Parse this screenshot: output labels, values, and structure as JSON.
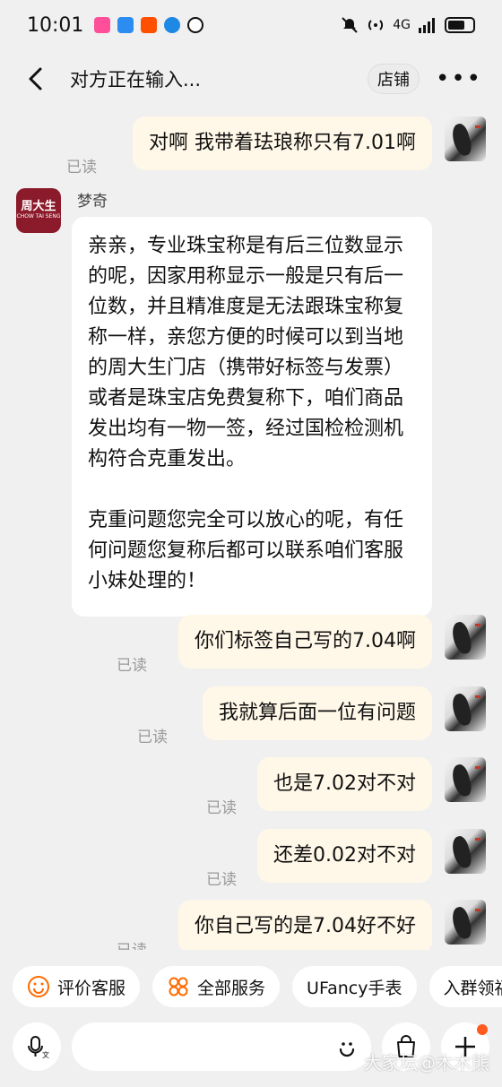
{
  "status_bar": {
    "time": "10:01",
    "network": "4G",
    "icons": [
      "video-app-icon",
      "browser-app-icon",
      "taobao-app-icon",
      "browser2-app-icon",
      "qq-app-icon"
    ]
  },
  "header": {
    "title": "对方正在输入...",
    "shop_label": "店铺",
    "more_label": "•••"
  },
  "chat": {
    "shop_name": "梦奇",
    "shop_logo_cn": "周大生",
    "shop_logo_en": "CHOW TAI SENG",
    "read_label": "已读",
    "messages": {
      "m1": "对啊 我带着珐琅称只有7.01啊",
      "shop_p1": "亲亲，专业珠宝称是有后三位数显示的呢，因家用称显示一般是只有后一位数，并且精准度是无法跟珠宝称复称一样，亲您方便的时候可以到当地的周大生门店（携带好标签与发票）或者是珠宝店免费复称下，咱们商品发出均有一物一签，经过国检检测机构符合克重发出。",
      "shop_p2": "克重问题您完全可以放心的呢，有任何问题您复称后都可以联系咱们客服小妹处理的！",
      "m2": "你们标签自己写的7.04啊",
      "m3": "我就算后面一位有问题",
      "m4": "也是7.02对不对",
      "m5": "还差0.02对不对",
      "m6": "你自己写的是7.04好不好"
    }
  },
  "quick_bar": {
    "chips": [
      "评价客服",
      "全部服务",
      "UFancy手表",
      "入群领福"
    ]
  },
  "input_bar": {
    "placeholder": "",
    "watermark": "大家坛@木木熊"
  },
  "colors": {
    "background": "#f0f0f0",
    "my_bubble": "#fff8e8",
    "shop_bubble": "#ffffff",
    "brand": "#8b1a2b",
    "accent": "#ff5a1f"
  }
}
